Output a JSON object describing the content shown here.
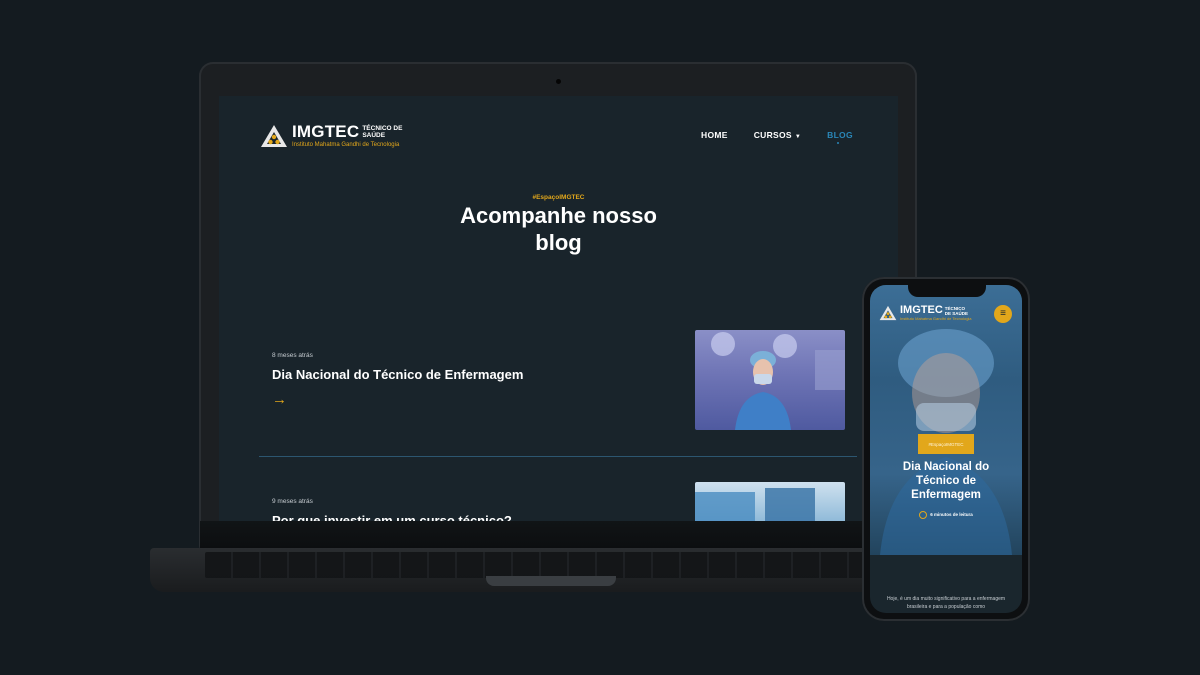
{
  "laptop_site": {
    "logo": {
      "name": "IMGTEC",
      "tag": "TÉCNICO DE SAÚDE",
      "subtitle": "Instituto Mahatma Gandhi de Tecnologia"
    },
    "nav": {
      "home": "HOME",
      "cursos": "CURSOS",
      "blog": "BLOG"
    },
    "hero": {
      "hashtag": "#EspaçoIMGTEC",
      "title": "Acompanhe nosso blog"
    },
    "posts": [
      {
        "meta": "8 meses atrás",
        "title": "Dia Nacional do Técnico de Enfermagem",
        "arrow": "→"
      },
      {
        "meta": "9 meses atrás",
        "title": "Por que investir em um curso técnico?"
      }
    ]
  },
  "phone_site": {
    "logo": {
      "name": "IMGTEC",
      "tag": "TÉCNICO DE SAÚDE",
      "subtitle": "Instituto Mahatma Gandhi de Tecnologia"
    },
    "menu_icon": "≡",
    "hashtag": "#EspaçoIMGTEC",
    "title": "Dia Nacional do Técnico de Enfermagem",
    "read_time": "6 minutos de leitura",
    "body": "Hoje, é um dia muito significativo para a enfermagem brasileira e para a população como"
  },
  "colors": {
    "accent": "#e2a71b",
    "active_nav": "#2a87b8",
    "site_bg": "#19242b",
    "page_bg": "#141b20"
  }
}
